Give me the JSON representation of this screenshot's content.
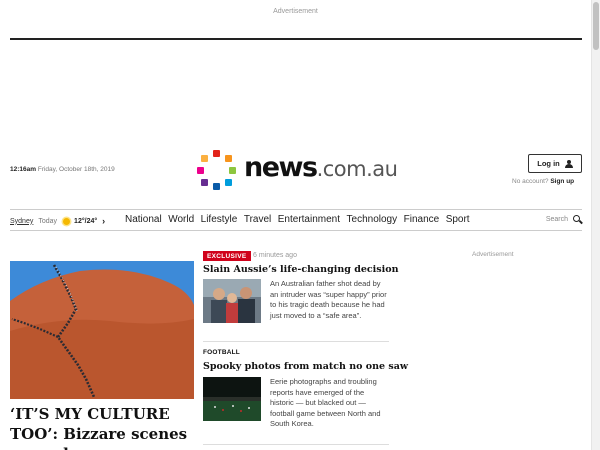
{
  "ads": {
    "top_label": "Advertisement",
    "side_label": "Advertisement"
  },
  "header": {
    "time": "12:16am",
    "date": "Friday, October 18th, 2019",
    "logo_main": "news",
    "logo_suffix": ".com.au",
    "login_label": "Log in",
    "no_account_text": "No account?",
    "signup_label": "Sign up"
  },
  "weather": {
    "city": "Sydney",
    "day": "Today",
    "temps": "12°/24°"
  },
  "nav": {
    "items": [
      "National",
      "World",
      "Lifestyle",
      "Travel",
      "Entertainment",
      "Technology",
      "Finance",
      "Sport"
    ],
    "search_label": "Search"
  },
  "hero": {
    "title": "‘IT’S MY CULTURE TOO’: Bizzare scenes on rock"
  },
  "stories": [
    {
      "tag": "EXCLUSIVE",
      "time": "6 minutes ago",
      "title": "Slain Aussie’s life-changing decision",
      "text": "An Australian father shot dead by an intruder was “super happy” prior to his tragic death because he had just moved to a “safe area”."
    },
    {
      "category": "FOOTBALL",
      "title": "Spooky photos from match no one saw",
      "text": "Eerie photographs and troubling reports have emerged of the historic — but blacked out — football game between North and South Korea."
    }
  ],
  "colors": {
    "accent": "#d0021b",
    "logo_dots": [
      "#e2231a",
      "#f7941d",
      "#8dc63f",
      "#009ddc",
      "#0a5ba8",
      "#662d91",
      "#ec008c",
      "#fbb040"
    ]
  }
}
